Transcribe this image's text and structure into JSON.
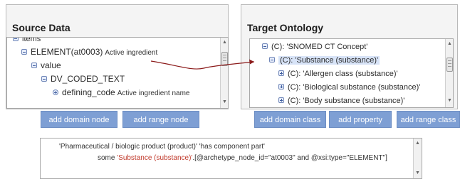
{
  "source": {
    "title": "Source Data",
    "items_label": "items",
    "element_id": "ELEMENT(at0003)",
    "element_desc": "Active ingredient",
    "value_label": "value",
    "dv_label": "DV_CODED_TEXT",
    "defining_code": "defining_code",
    "defining_code_desc": "Active ingredient name",
    "buttons": {
      "add_domain_node": "add domain node",
      "add_range_node": "add range node"
    }
  },
  "target": {
    "title": "Target Ontology",
    "nodes": [
      "(C): 'SNOMED CT Concept'",
      "(C): 'Substance (substance)'",
      "(C): 'Allergen class (substance)'",
      "(C): 'Biological substance (substance)'",
      "(C): 'Body substance (substance)'"
    ],
    "buttons": {
      "add_domain_class": "add domain class",
      "add_property": "add property",
      "add_range_class": "add range class"
    }
  },
  "expression": {
    "line1": "'Pharmaceutical / biologic product (product)' 'has component part'",
    "line2_prefix": "some ",
    "line2_highlight": "'Substance (substance)'",
    "line2_suffix": ".[@archetype_node_id=\"at0003\" and @xsi:type=\"ELEMENT\"]"
  },
  "colors": {
    "button_bg": "#7e9fd4",
    "arrow": "#8b1a1a",
    "highlight_text": "#c0392b"
  }
}
